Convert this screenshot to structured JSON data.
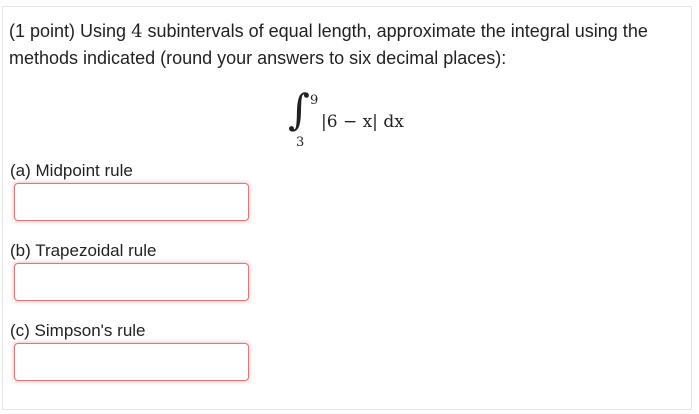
{
  "problem": {
    "intro_prefix": "(1 point) Using ",
    "intro_number": "4",
    "intro_suffix": " subintervals of equal length, approximate the integral using the methods indicated (round your answers to six decimal places):",
    "integral": {
      "symbol": "∫",
      "upper_limit": "9",
      "lower_limit": "3",
      "integrand": "|6 − x| dx"
    }
  },
  "parts": [
    {
      "label": "(a) Midpoint rule",
      "value": "",
      "placeholder": ""
    },
    {
      "label": "(b) Trapezoidal rule",
      "value": "",
      "placeholder": ""
    },
    {
      "label": "(c) Simpson's rule",
      "value": "",
      "placeholder": ""
    }
  ],
  "colors": {
    "text": "#222222",
    "border": "#e4e4e4",
    "input_error_border": "#d97a7a"
  }
}
